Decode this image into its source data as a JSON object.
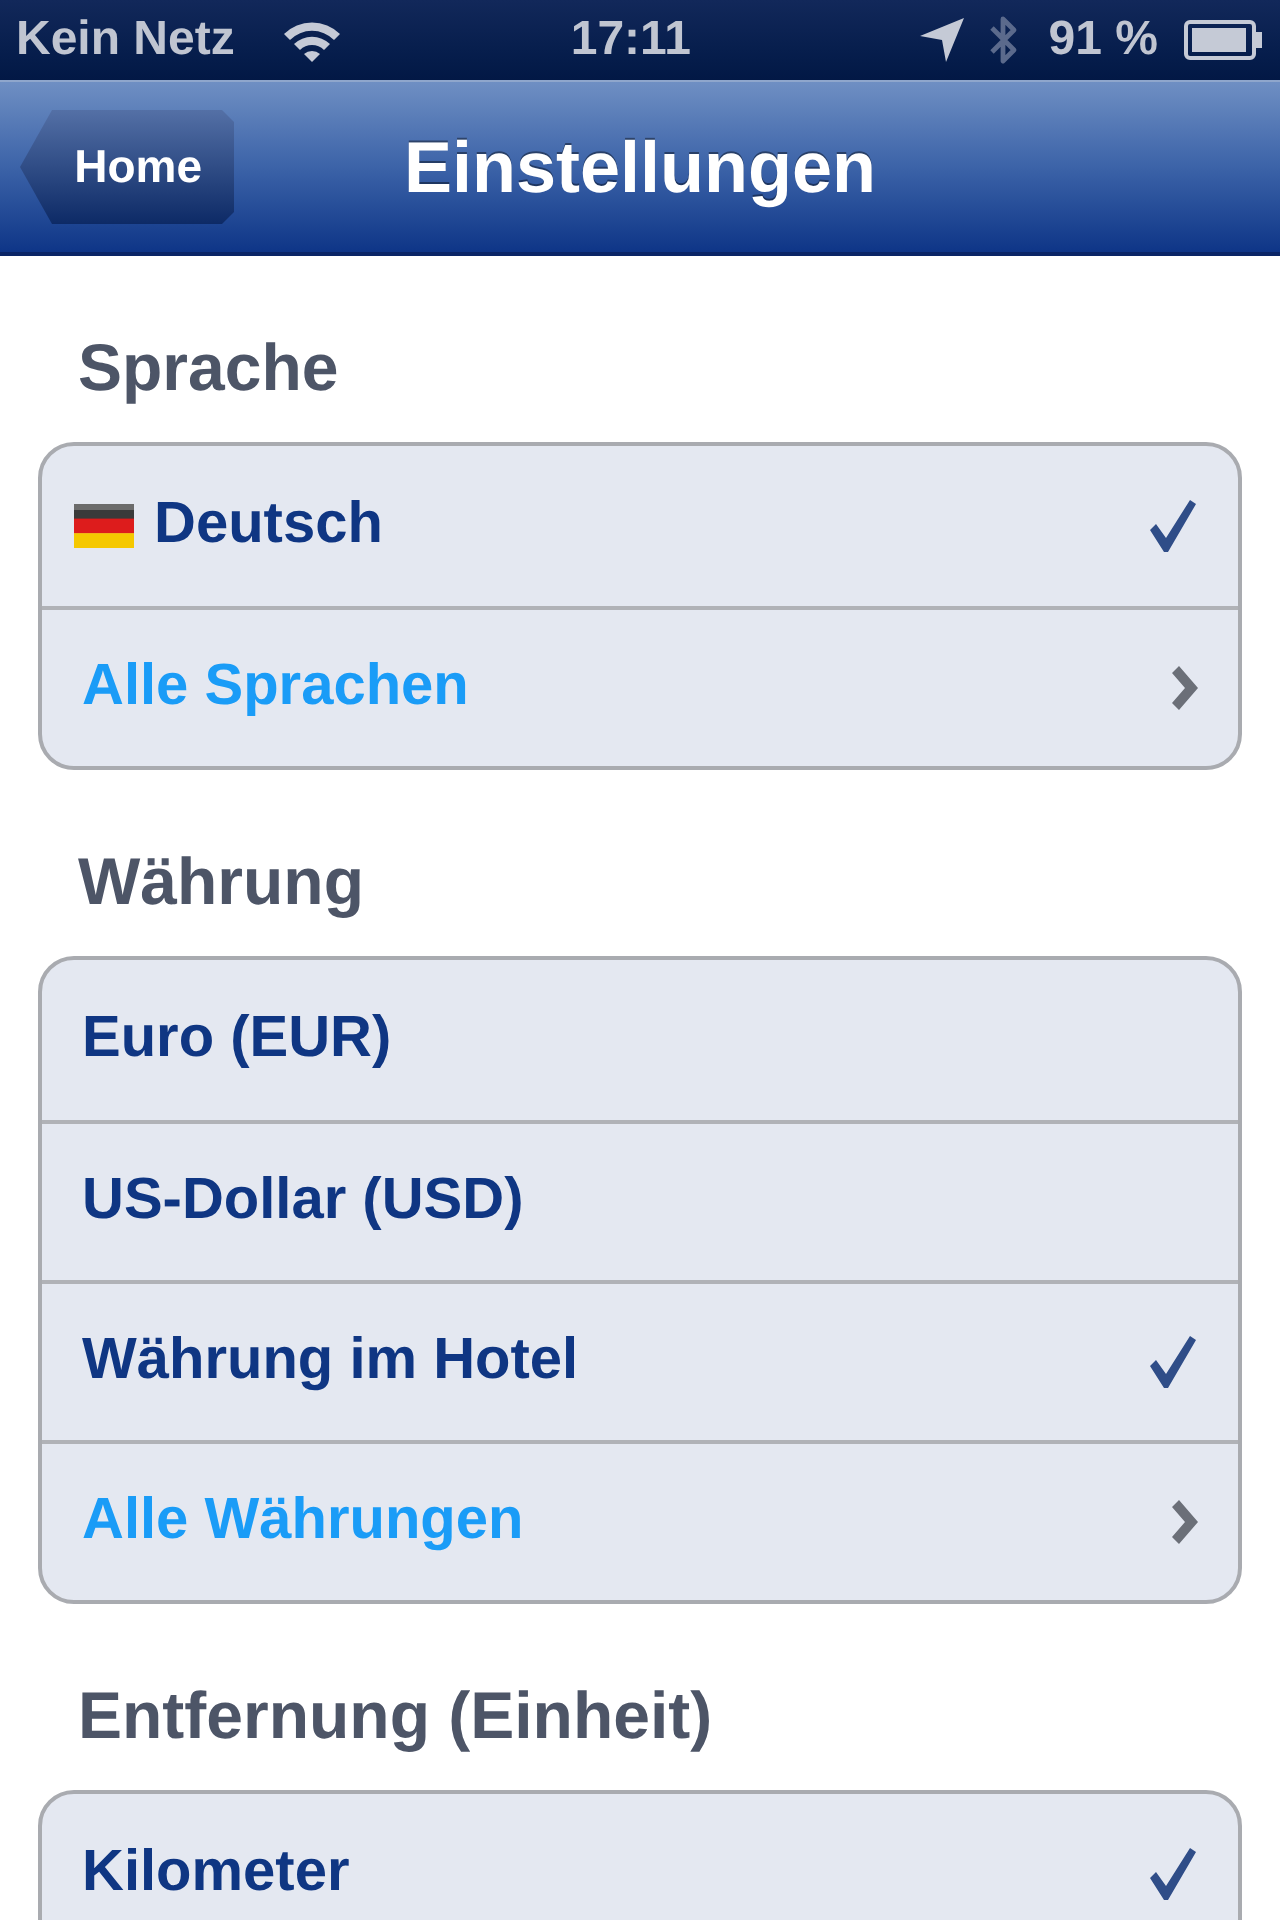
{
  "status_bar": {
    "carrier": "Kein Netz",
    "time": "17:11",
    "battery": "91 %"
  },
  "nav_bar": {
    "back_button": "Home",
    "title": "Einstellungen"
  },
  "sections": [
    {
      "header": "Sprache",
      "rows": [
        {
          "kind": "language",
          "label": "Deutsch",
          "selected": true
        },
        {
          "kind": "more",
          "label": "Alle Sprachen"
        }
      ]
    },
    {
      "header": "Währung",
      "rows": [
        {
          "kind": "option",
          "label": "Euro (EUR)",
          "selected": false
        },
        {
          "kind": "option",
          "label": "US-Dollar (USD)",
          "selected": false
        },
        {
          "kind": "option",
          "label": "Währung im Hotel",
          "selected": true
        },
        {
          "kind": "more",
          "label": "Alle Währungen"
        }
      ]
    },
    {
      "header": "Entfernung (Einheit)",
      "rows": [
        {
          "kind": "option",
          "label": "Kilometer",
          "selected": true
        }
      ]
    }
  ]
}
